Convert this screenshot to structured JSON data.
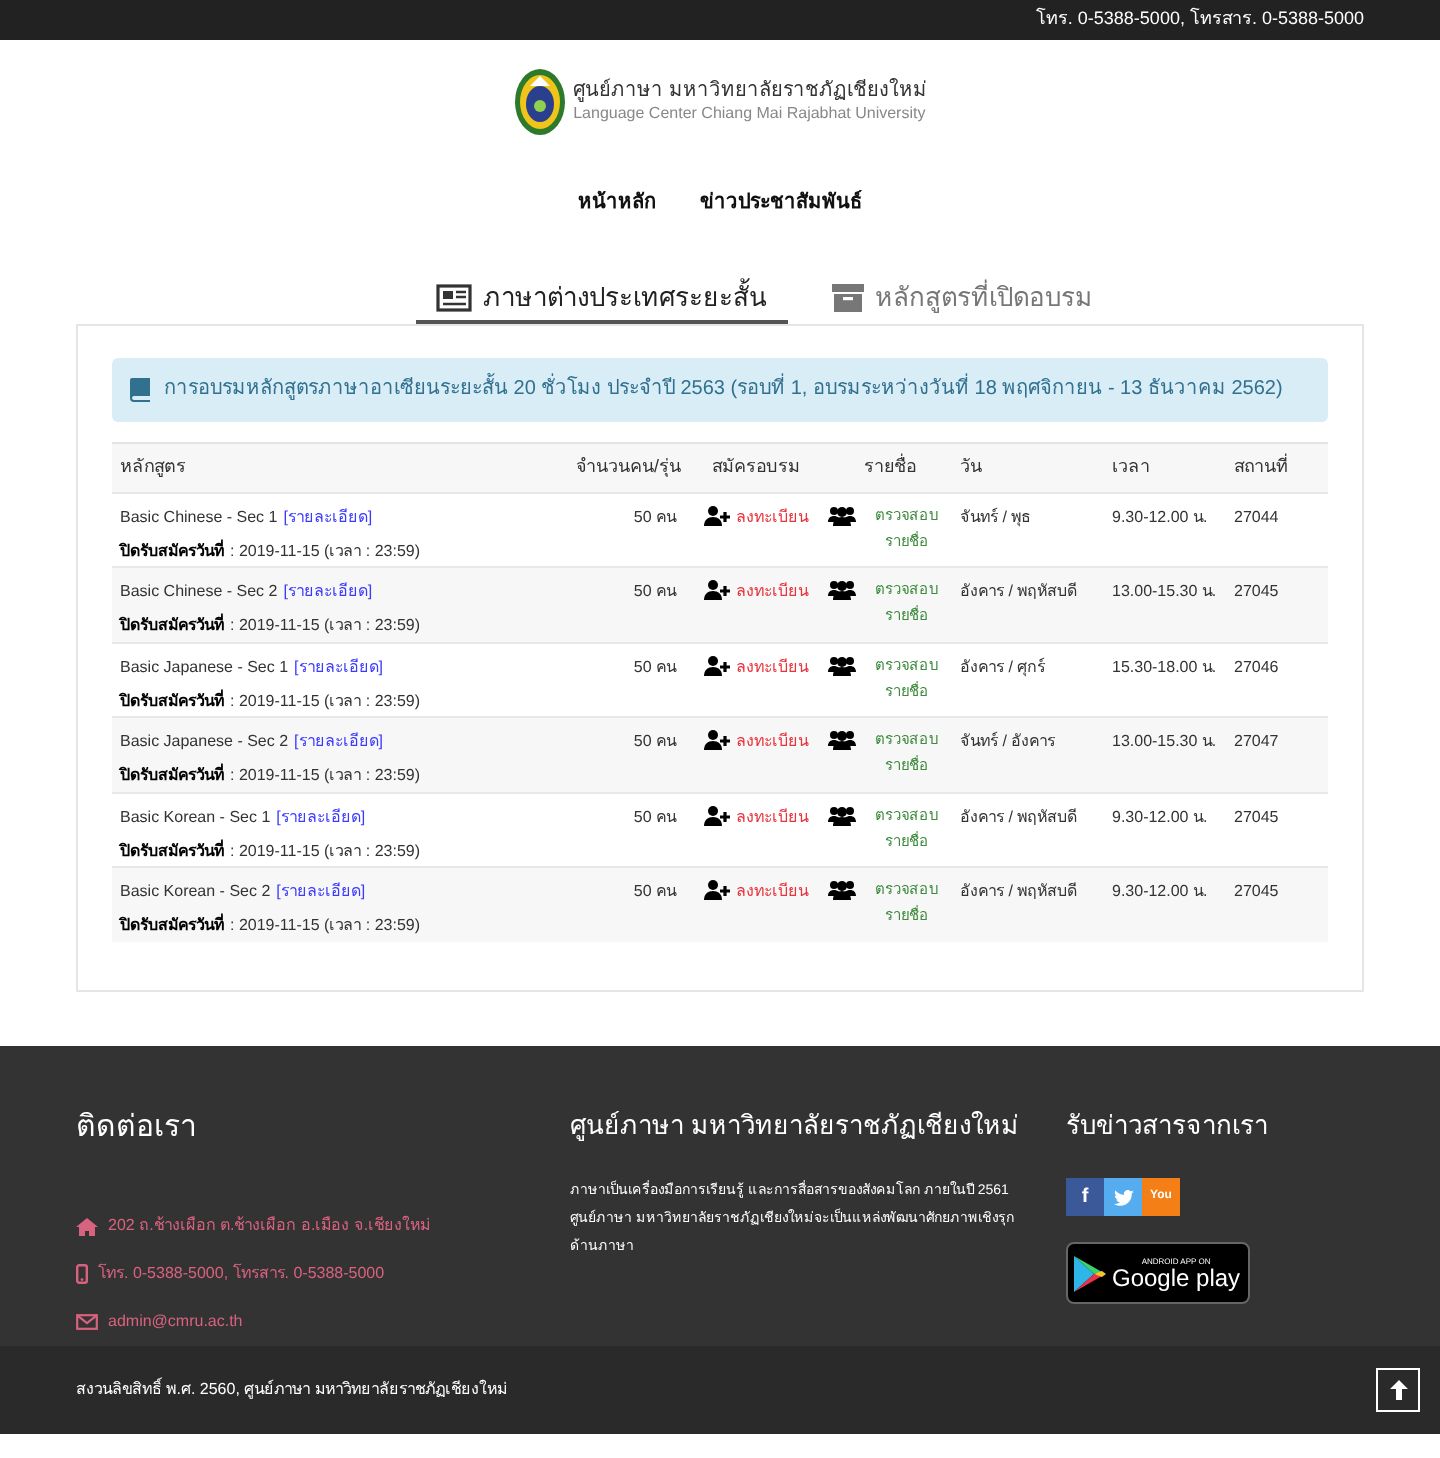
{
  "top_bar": {
    "contact": "โทร. 0-5388-5000, โทรสาร. 0-5388-5000"
  },
  "header": {
    "name_th": "ศูนย์ภาษา มหาวิทยาลัยราชภัฏเชียงใหม่",
    "name_en": "Language Center Chiang Mai Rajabhat University"
  },
  "nav": [
    "หน้าหลัก",
    "ข่าวประชาสัมพันธ์"
  ],
  "tabs": [
    {
      "label": "ภาษาต่างประเทศระยะสั้น",
      "selected": true
    },
    {
      "label": "หลักสูตรที่เปิดอบรม",
      "selected": false
    }
  ],
  "alert": "การอบรมหลักสูตรภาษาอาเซียนระยะสั้น 20 ชั่วโมง ประจำปี 2563 (รอบที่ 1, อบรมระหว่างวันที่ 18 พฤศจิกายน - 13 ธันวาคม 2562)",
  "table": {
    "columns": [
      "หลักสูตร",
      "จำนวนคน/รุ่น",
      "สมัครอบรม",
      "รายชื่อ",
      "วัน",
      "เวลา",
      "สถานที่"
    ],
    "rows": [
      {
        "course": "Basic Chinese - Sec 1",
        "link": "[รายละเอียด]",
        "close_label": "ปิดรับสมัครวันที่",
        "close_date": ": 2019-11-15 (เวลา : 23:59)",
        "count": "50 คน",
        "register": "ลงทะเบียน",
        "check": "ตรวจสอบ รายชื่อ",
        "day": "จันทร์ / พุธ",
        "time": "9.30-12.00 น.",
        "place": "27044"
      },
      {
        "course": "Basic Chinese - Sec 2",
        "link": "[รายละเอียด]",
        "close_label": "ปิดรับสมัครวันที่",
        "close_date": ": 2019-11-15 (เวลา : 23:59)",
        "count": "50 คน",
        "register": "ลงทะเบียน",
        "check": "ตรวจสอบ รายชื่อ",
        "day": "อังคาร / พฤหัสบดี",
        "time": "13.00-15.30 น.",
        "place": "27045"
      },
      {
        "course": "Basic Japanese - Sec 1",
        "link": "[รายละเอียด]",
        "close_label": "ปิดรับสมัครวันที่",
        "close_date": ": 2019-11-15 (เวลา : 23:59)",
        "count": "50 คน",
        "register": "ลงทะเบียน",
        "check": "ตรวจสอบ รายชื่อ",
        "day": "อังคาร / ศุกร์",
        "time": "15.30-18.00 น.",
        "place": "27046"
      },
      {
        "course": "Basic Japanese - Sec 2",
        "link": "[รายละเอียด]",
        "close_label": "ปิดรับสมัครวันที่",
        "close_date": ": 2019-11-15 (เวลา : 23:59)",
        "count": "50 คน",
        "register": "ลงทะเบียน",
        "check": "ตรวจสอบ รายชื่อ",
        "day": "จันทร์ / อังคาร",
        "time": "13.00-15.30 น.",
        "place": "27047"
      },
      {
        "course": "Basic Korean - Sec 1",
        "link": "[รายละเอียด]",
        "close_label": "ปิดรับสมัครวันที่",
        "close_date": ": 2019-11-15 (เวลา : 23:59)",
        "count": "50 คน",
        "register": "ลงทะเบียน",
        "check": "ตรวจสอบ รายชื่อ",
        "day": "อังคาร / พฤหัสบดี",
        "time": "9.30-12.00 น.",
        "place": "27045"
      },
      {
        "course": "Basic Korean - Sec 2",
        "link": "[รายละเอียด]",
        "close_label": "ปิดรับสมัครวันที่",
        "close_date": ": 2019-11-15 (เวลา : 23:59)",
        "count": "50 คน",
        "register": "ลงทะเบียน",
        "check": "ตรวจสอบ รายชื่อ",
        "day": "อังคาร / พฤหัสบดี",
        "time": "9.30-12.00 น.",
        "place": "27045"
      }
    ]
  },
  "footer": {
    "contact": {
      "heading": "ติดต่อเรา",
      "address": "202 ถ.ช้างเผือก ต.ช้างเผือก อ.เมือง จ.เชียงใหม่",
      "phone": "โทร. 0-5388-5000, โทรสาร. 0-5388-5000",
      "email": "admin@cmru.ac.th"
    },
    "about": {
      "heading": "ศูนย์ภาษา มหาวิทยาลัยราชภัฏเชียงใหม่",
      "text": "ภาษาเป็นเครื่องมือการเรียนรู้ และการสื่อสารของสังคมโลก ภายในปี 2561 ศูนย์ภาษา มหาวิทยาลัยราชภัฏเชียงใหม่จะเป็นแหล่งพัฒนาศักยภาพเชิงรุก ด้านภาษา"
    },
    "news": {
      "heading": "รับข่าวสารจากเรา",
      "social": [
        {
          "kind": "facebook",
          "label": "f"
        },
        {
          "kind": "twitter"
        },
        {
          "kind": "youtube",
          "label": "You"
        }
      ],
      "store_badge": {
        "small": "ANDROID APP ON",
        "big": "Google play"
      }
    }
  },
  "copyright": "สงวนลิขสิทธิ์ พ.ศ. 2560, ศูนย์ภาษา มหาวิทยาลัยราชภัฏเชียงใหม่"
}
